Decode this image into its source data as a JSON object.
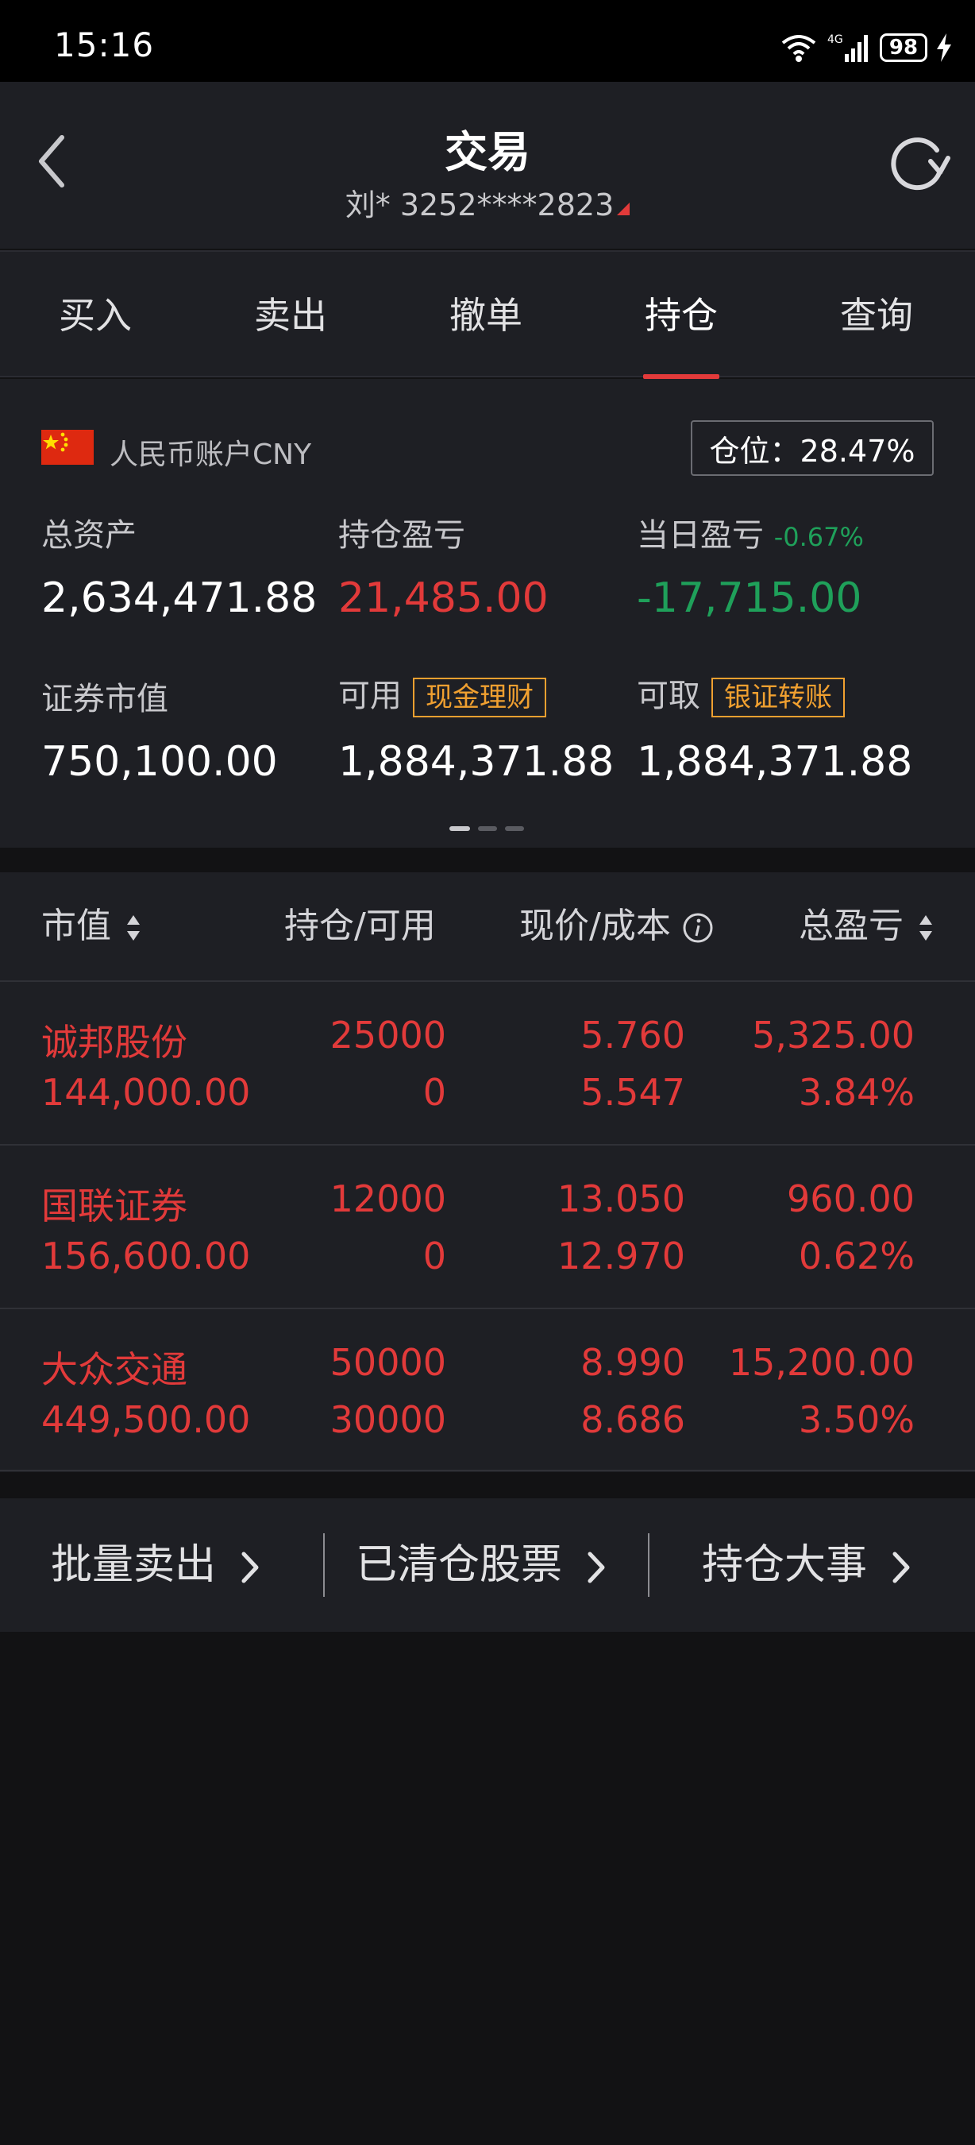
{
  "status_bar": {
    "time": "15:16",
    "network": "4G",
    "wifi_label": "6",
    "battery": "98"
  },
  "header": {
    "title": "交易",
    "account": "刘* 3252****2823"
  },
  "tabs": [
    {
      "label": "买入"
    },
    {
      "label": "卖出"
    },
    {
      "label": "撤单"
    },
    {
      "label": "持仓",
      "active": true
    },
    {
      "label": "查询"
    }
  ],
  "account": {
    "label": "人民币账户CNY",
    "position_ratio": "仓位：28.47%",
    "total_assets_label": "总资产",
    "total_assets": "2,634,471.88",
    "holding_pl_label": "持仓盈亏",
    "holding_pl": "21,485.00",
    "daily_pl_label": "当日盈亏",
    "daily_pl_pct": "-0.67%",
    "daily_pl": "-17,715.00",
    "market_value_label": "证券市值",
    "market_value": "750,100.00",
    "available_label": "可用",
    "available_tag": "现金理财",
    "available": "1,884,371.88",
    "withdrawable_label": "可取",
    "withdrawable_tag": "银证转账",
    "withdrawable": "1,884,371.88"
  },
  "table": {
    "headers": {
      "market_value": "市值",
      "holding": "持仓/可用",
      "price_cost": "现价/成本",
      "total_pl": "总盈亏"
    },
    "rows": [
      {
        "name": "诚邦股份",
        "market_value": "144,000.00",
        "holding": "25000",
        "available": "0",
        "price": "5.760",
        "cost": "5.547",
        "pl": "5,325.00",
        "pl_pct": "3.84%"
      },
      {
        "name": "国联证券",
        "market_value": "156,600.00",
        "holding": "12000",
        "available": "0",
        "price": "13.050",
        "cost": "12.970",
        "pl": "960.00",
        "pl_pct": "0.62%"
      },
      {
        "name": "大众交通",
        "market_value": "449,500.00",
        "holding": "50000",
        "available": "30000",
        "price": "8.990",
        "cost": "8.686",
        "pl": "15,200.00",
        "pl_pct": "3.50%"
      }
    ]
  },
  "bottom_bar": {
    "batch_sell": "批量卖出",
    "cleared_stocks": "已清仓股票",
    "holding_events": "持仓大事"
  },
  "colors": {
    "up": "#e23a3a",
    "down": "#1fa05a",
    "tag": "#f0a030",
    "panel": "#1e1f24",
    "background": "#121214"
  }
}
